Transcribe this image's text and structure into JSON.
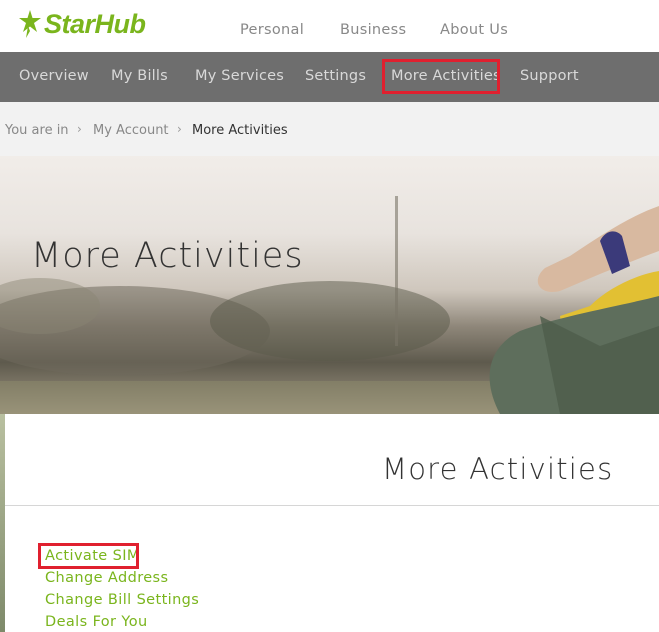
{
  "brand": {
    "name": "StarHub",
    "color": "#7ab51d",
    "logo_icon": "star-figure-icon"
  },
  "top_nav": [
    "Personal",
    "Business",
    "About Us"
  ],
  "main_nav": {
    "items": [
      "Overview",
      "My Bills",
      "My Services",
      "Settings",
      "More Activities",
      "Support"
    ],
    "highlighted": "More Activities",
    "highlight_color": "#e0202f"
  },
  "breadcrumb": {
    "prefix": "You are in",
    "items": [
      "My Account",
      "More Activities"
    ]
  },
  "hero": {
    "title": "More Activities"
  },
  "panel": {
    "title": "More Activities",
    "links": [
      "Activate SIM",
      "Change Address",
      "Change Bill Settings",
      "Deals For You"
    ],
    "highlighted_link": "Activate SIM"
  }
}
